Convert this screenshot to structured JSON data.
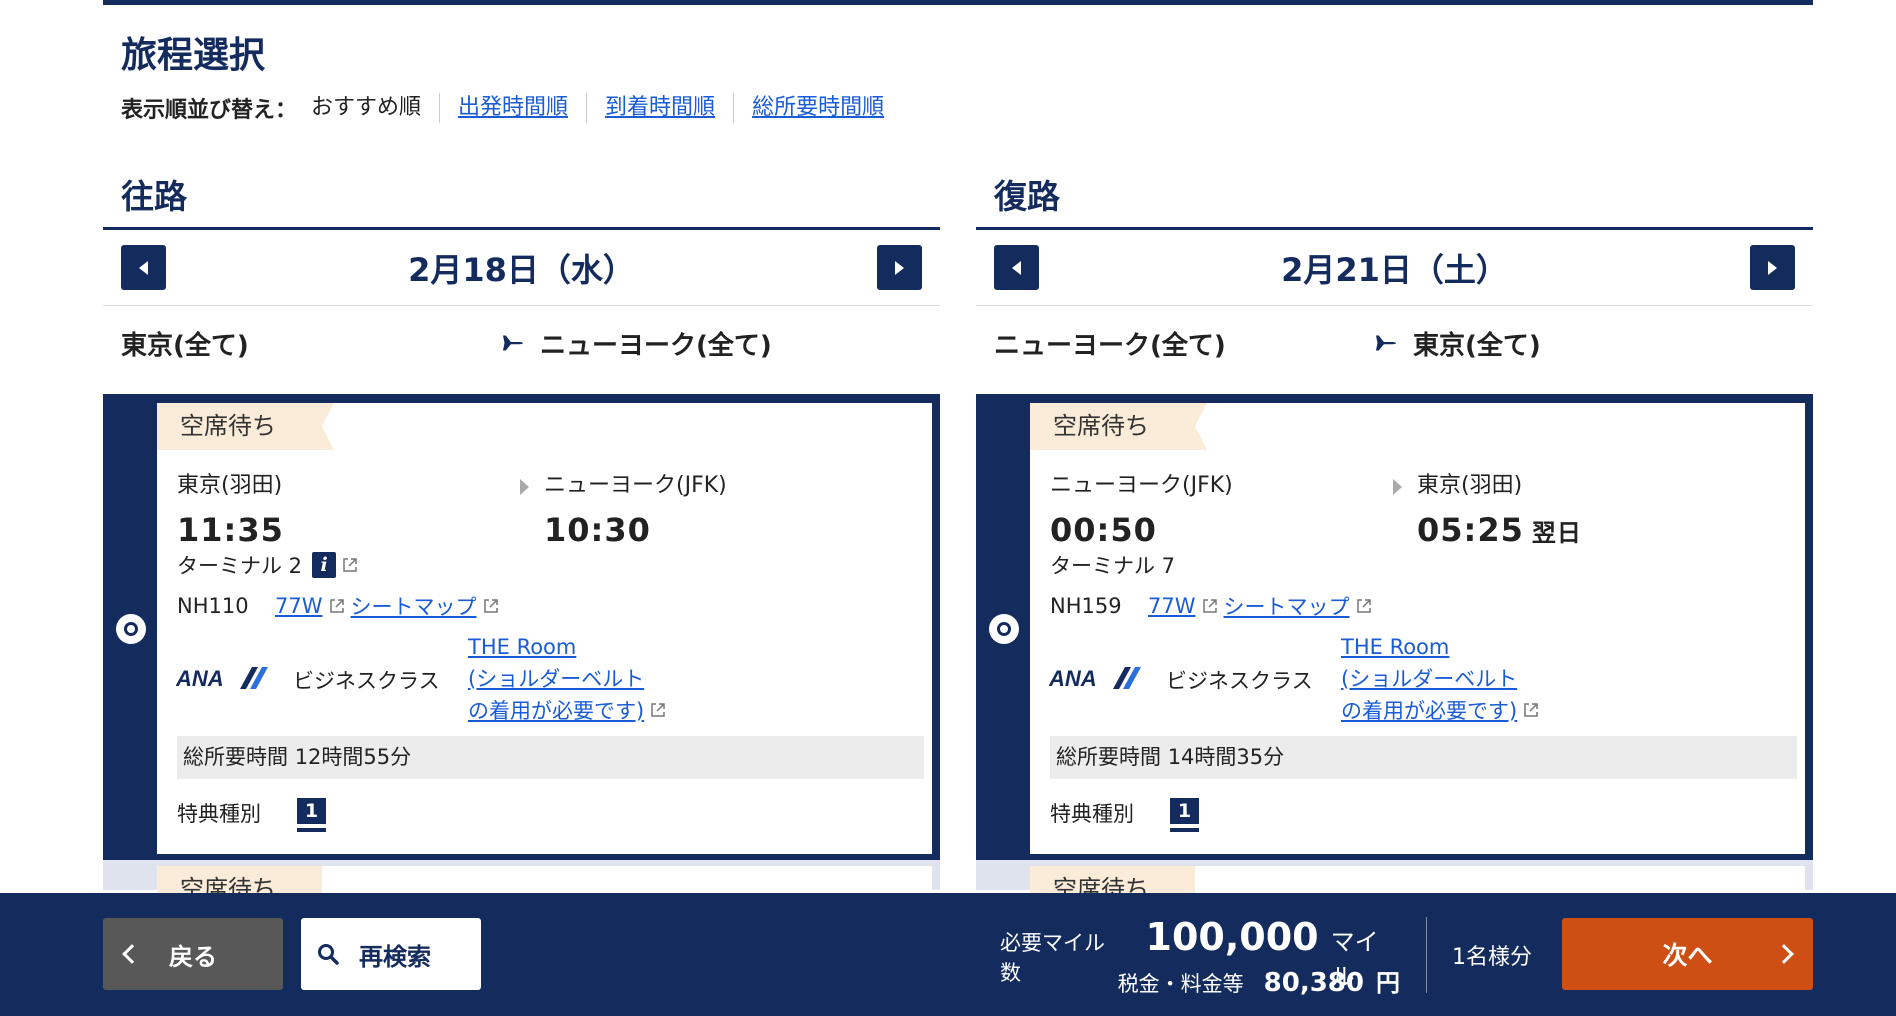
{
  "page": {
    "title": "旅程選択"
  },
  "sort": {
    "label": "表示順並び替え：",
    "options": [
      "おすすめ順",
      "出発時間順",
      "到着時間順",
      "総所要時間順"
    ]
  },
  "outbound": {
    "title": "往路",
    "date": "2月18日（水）",
    "route_from": "東京(全て)",
    "route_to": "ニューヨーク(全て)",
    "flight": {
      "status": "空席待ち",
      "dep_city": "東京(羽田)",
      "dep_time": "11:35",
      "arr_city": "ニューヨーク(JFK)",
      "arr_time": "10:30",
      "arr_note": "",
      "terminal": "ターミナル 2",
      "flight_no": "NH110",
      "aircraft": "77W",
      "seatmap": "シートマップ",
      "airline": "ANA",
      "cabin": "ビジネスクラス",
      "lounge_lines": [
        "THE Room",
        "(ショルダーベルト",
        "の着用が必要です)"
      ],
      "duration_label": "総所要時間",
      "duration": "12時間55分",
      "award_label": "特典種別",
      "award_type": "1",
      "next_status": "空席待ち"
    }
  },
  "return": {
    "title": "復路",
    "date": "2月21日（土）",
    "route_from": "ニューヨーク(全て)",
    "route_to": "東京(全て)",
    "flight": {
      "status": "空席待ち",
      "dep_city": "ニューヨーク(JFK)",
      "dep_time": "00:50",
      "arr_city": "東京(羽田)",
      "arr_time": "05:25",
      "arr_note": "翌日",
      "terminal": "ターミナル 7",
      "flight_no": "NH159",
      "aircraft": "77W",
      "seatmap": "シートマップ",
      "airline": "ANA",
      "cabin": "ビジネスクラス",
      "lounge_lines": [
        "THE Room",
        "(ショルダーベルト",
        "の着用が必要です)"
      ],
      "duration_label": "総所要時間",
      "duration": "14時間35分",
      "award_label": "特典種別",
      "award_type": "1",
      "next_status": "空席待ち"
    }
  },
  "footer": {
    "back_label": "戻る",
    "research_label": "再検索",
    "miles_label": "必要マイル数",
    "miles_value": "100,000",
    "miles_unit": "マイル",
    "tax_label": "税金・料金等",
    "tax_value": "80,380",
    "tax_unit": "円",
    "pax_label": "1名様分",
    "next_label": "次へ"
  },
  "colors": {
    "navy": "#142b5e",
    "orange": "#cd4f14",
    "link": "#1a5cd6",
    "badge_bg": "#fbecd9"
  }
}
